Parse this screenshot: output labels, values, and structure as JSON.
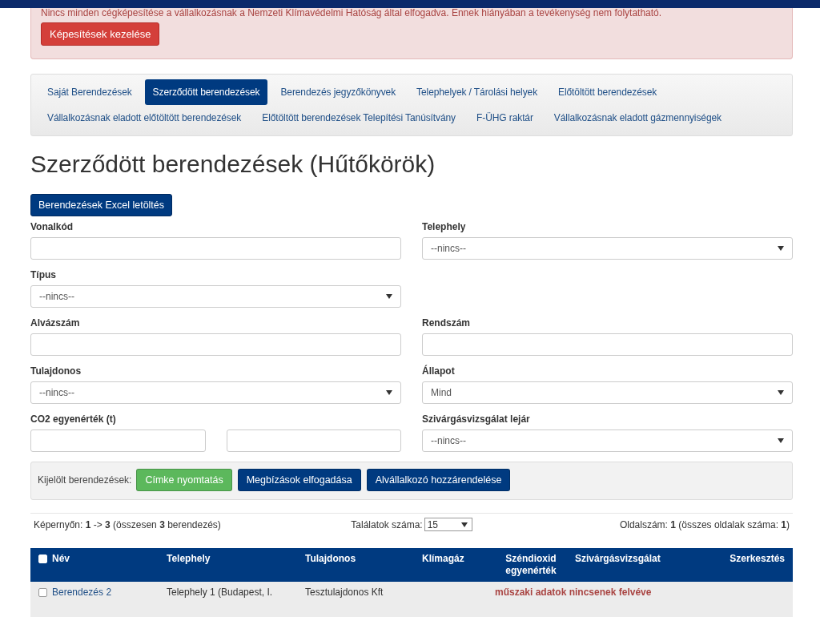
{
  "alert": {
    "message": "Nincs minden cégképesítése a vállalkozásnak a Nemzeti Klímavédelmi Hatóság által elfogadva. Ennek hiányában a tevékenység nem folytatható.",
    "button": "Képesítések kezelése"
  },
  "tabs": [
    {
      "label": "Saját Berendezések",
      "selected": false
    },
    {
      "label": "Szerződött berendezések",
      "selected": true
    },
    {
      "label": "Berendezés jegyzőkönyvek",
      "selected": false
    },
    {
      "label": "Telephelyek / Tárolási helyek",
      "selected": false
    },
    {
      "label": "Előtöltött berendezések",
      "selected": false
    },
    {
      "label": "Vállalkozásnak eladott előtöltött berendezések",
      "selected": false
    },
    {
      "label": "Előtöltött berendezések Telepítési Tanúsítvány",
      "selected": false
    },
    {
      "label": "F-ÜHG raktár",
      "selected": false
    },
    {
      "label": "Vállalkozásnak eladott gázmennyiségek",
      "selected": false
    }
  ],
  "heading": "Szerződött berendezések (Hűtőkörök)",
  "excel_button": "Berendezések Excel letöltés",
  "filter_rows": [
    [
      {
        "label": "Vonalkód",
        "kind": "text"
      },
      {
        "label": "Telephely",
        "kind": "select",
        "value": "--nincs--"
      }
    ],
    [
      {
        "label": "Típus",
        "kind": "select",
        "value": "--nincs--"
      }
    ],
    [
      {
        "label": "Alvázszám",
        "kind": "text"
      },
      {
        "label": "Rendszám",
        "kind": "text"
      }
    ],
    [
      {
        "label": "Tulajdonos",
        "kind": "select",
        "value": "--nincs--"
      },
      {
        "label": "Állapot",
        "kind": "select",
        "value": "Mind"
      }
    ],
    [
      {
        "label": "CO2 egyenérték (t)",
        "kind": "range"
      },
      {
        "label": "Szivárgásvizsgálat lejár",
        "kind": "select",
        "value": "--nincs--"
      }
    ]
  ],
  "selection_bar": {
    "label": "Kijelölt berendezések:",
    "buttons": [
      {
        "label": "Címke nyomtatás",
        "color": "#5cb85c"
      },
      {
        "label": "Megbízások elfogadása",
        "color": "#003a80"
      },
      {
        "label": "Alvállalkozó hozzárendelése",
        "color": "#003a80"
      }
    ]
  },
  "pager": {
    "summary": "Képernyőn: **1** -> **3** (összesen **3** berendezés)",
    "page_size_label": "Találatok száma:",
    "page_size": "15",
    "page_info": "Oldalszám: **1** (összes oldalak száma: **1**)"
  },
  "table": {
    "all_checked": false,
    "columns": [
      "Név",
      "Telephely",
      "Tulajdonos",
      "Klímagáz",
      "Széndioxid egyenérték",
      "Szivárgásvizsgálat",
      "Szerkesztés"
    ],
    "rows": [
      {
        "checked": false,
        "name": "Berendezés 2",
        "site": "Telephely 1 (Budapest, I.",
        "owner": "Tesztulajdonos Kft",
        "notice": "műszaki adatok nincsenek felvéve"
      }
    ]
  }
}
